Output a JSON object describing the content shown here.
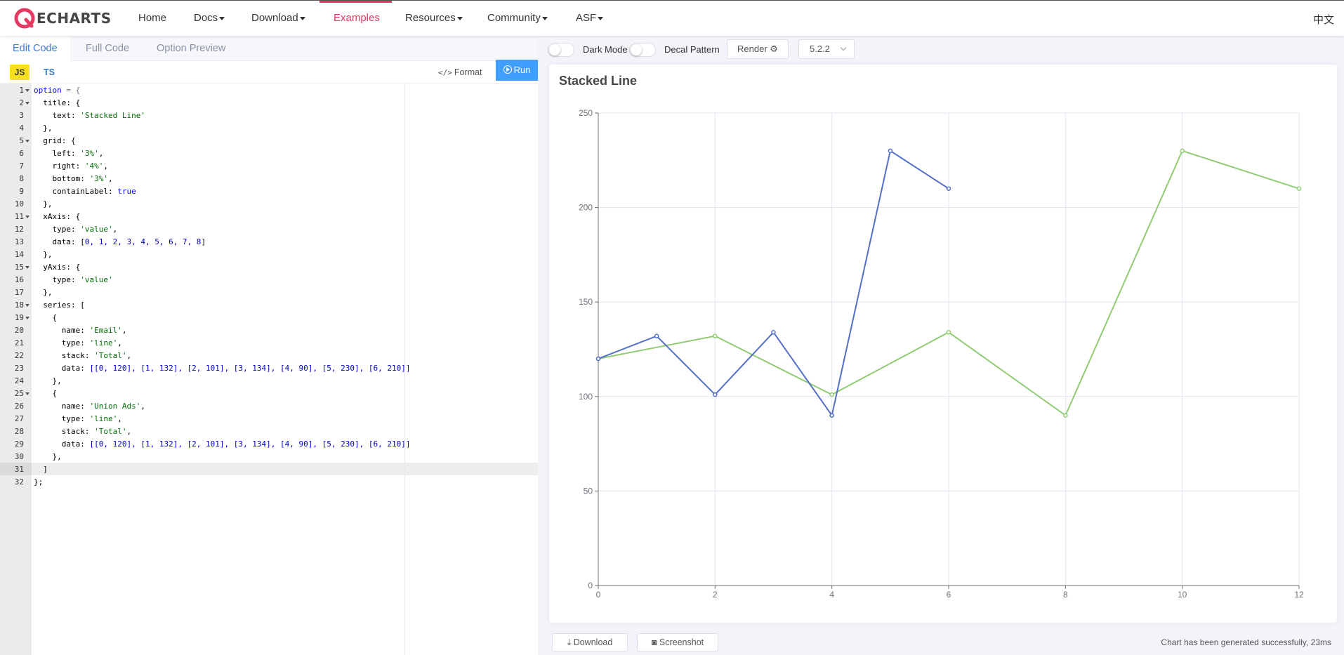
{
  "nav": {
    "logo_text": "ECHARTS",
    "items": [
      "Home",
      "Docs",
      "Download",
      "Examples",
      "Resources",
      "Community",
      "ASF"
    ],
    "lang": "中文"
  },
  "editor": {
    "tabs": [
      "Edit Code",
      "Full Code",
      "Option Preview"
    ],
    "lang_js": "JS",
    "lang_ts": "TS",
    "format_label": "Format",
    "run_label": "Run",
    "active_line": 32
  },
  "toolbar": {
    "dark_mode_label": "Dark Mode",
    "decal_label": "Decal Pattern",
    "render_label": "Render",
    "version": "5.2.2"
  },
  "bottom": {
    "download_label": "Download",
    "screenshot_label": "Screenshot",
    "status": "Chart has been generated successfully, 23ms"
  },
  "colors": {
    "accent": "#e43961",
    "run_blue": "#409eff",
    "series_email": "#5470c6",
    "series_union": "#91cc75"
  },
  "chart_data": {
    "type": "line",
    "title": "Stacked Line",
    "xlim": [
      0,
      12
    ],
    "ylim": [
      0,
      250
    ],
    "x_ticks": [
      0,
      2,
      4,
      6,
      8,
      10,
      12
    ],
    "y_ticks": [
      0,
      50,
      100,
      150,
      200,
      250
    ],
    "grid": true,
    "series": [
      {
        "name": "Email",
        "color": "#5470c6",
        "points": [
          [
            0,
            120
          ],
          [
            1,
            132
          ],
          [
            2,
            101
          ],
          [
            3,
            134
          ],
          [
            4,
            90
          ],
          [
            5,
            230
          ],
          [
            6,
            210
          ]
        ]
      },
      {
        "name": "Union Ads",
        "color": "#91cc75",
        "points": [
          [
            0,
            120
          ],
          [
            2,
            132
          ],
          [
            4,
            101
          ],
          [
            6,
            134
          ],
          [
            8,
            90
          ],
          [
            10,
            230
          ],
          [
            12,
            210
          ]
        ]
      }
    ]
  }
}
